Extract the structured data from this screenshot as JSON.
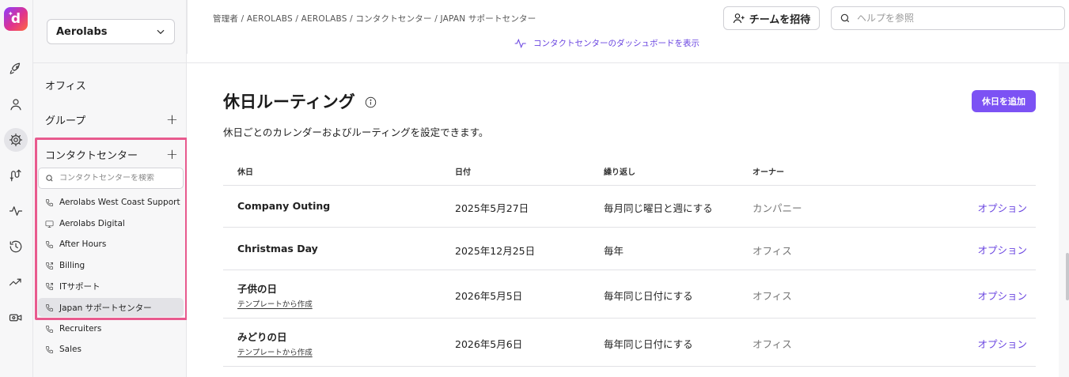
{
  "app": {
    "logo_letter": "d"
  },
  "rail": {
    "icons": [
      "rocket-icon",
      "user-icon",
      "gear-icon",
      "routing-icon",
      "activity-icon",
      "history-icon",
      "trending-icon",
      "video-icon"
    ],
    "active": "gear-icon"
  },
  "sidebar": {
    "org_select_value": "Aerolabs",
    "offices_label": "オフィス",
    "groups_label": "グループ",
    "contact_centers_label": "コンタクトセンター",
    "search_placeholder": "コンタクトセンターを検索",
    "items": [
      {
        "label": "Aerolabs West Coast Support",
        "icon": "phone-icon"
      },
      {
        "label": "Aerolabs Digital",
        "icon": "monitor-icon"
      },
      {
        "label": "After Hours",
        "icon": "phone-icon"
      },
      {
        "label": "Billing",
        "icon": "phone-transfer-icon"
      },
      {
        "label": "ITサポート",
        "icon": "phone-transfer-icon"
      },
      {
        "label": "Japan サポートセンター",
        "icon": "phone-icon",
        "selected": true
      },
      {
        "label": "Recruiters",
        "icon": "phone-icon"
      },
      {
        "label": "Sales",
        "icon": "phone-icon"
      }
    ],
    "highlight_color": "#e85a8e"
  },
  "header": {
    "breadcrumb": "管理者 / AEROLABS / AEROLABS / コンタクトセンター / JAPAN サポートセンター",
    "dashboard_link": "コンタクトセンターのダッシュボードを表示",
    "invite_button": "チームを招待",
    "help_placeholder": "ヘルプを参照"
  },
  "main": {
    "title": "休日ルーティング",
    "subtitle": "休日ごとのカレンダーおよびルーティングを設定できます。",
    "add_button": "休日を追加",
    "accent_color": "#7c52f4",
    "columns": {
      "holiday": "休日",
      "date": "日付",
      "repeat": "繰り返し",
      "owner": "オーナー"
    },
    "rows": [
      {
        "name": "Company Outing",
        "template": "",
        "date": "2025年5月27日",
        "repeat": "毎月同じ曜日と週にする",
        "owner": "カンパニー",
        "option": "オプション"
      },
      {
        "name": "Christmas Day",
        "template": "",
        "date": "2025年12月25日",
        "repeat": "毎年",
        "owner": "オフィス",
        "option": "オプション"
      },
      {
        "name": "子供の日",
        "template": "テンプレートから作成",
        "date": "2026年5月5日",
        "repeat": "毎年同じ日付にする",
        "owner": "オフィス",
        "option": "オプション"
      },
      {
        "name": "みどりの日",
        "template": "テンプレートから作成",
        "date": "2026年5月6日",
        "repeat": "毎年同じ日付にする",
        "owner": "オフィス",
        "option": "オプション"
      }
    ]
  }
}
